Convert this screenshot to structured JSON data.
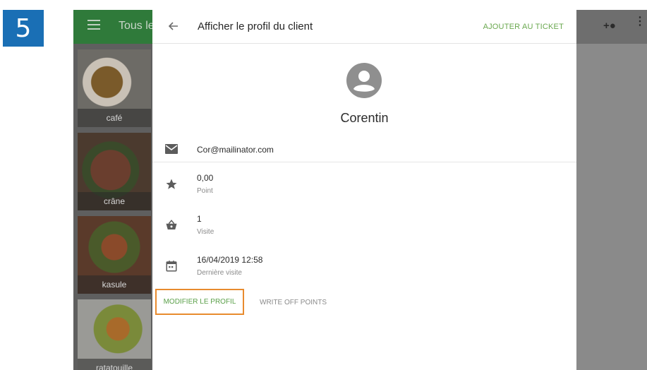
{
  "step_badge": "5",
  "background": {
    "app_title": "Tous le",
    "tiles": [
      {
        "label": "café"
      },
      {
        "label": "crâne"
      },
      {
        "label": "kasule"
      },
      {
        "label": "ratatouille"
      }
    ]
  },
  "sheet": {
    "title": "Afficher le profil du client",
    "action_add_ticket": "AJOUTER AU TICKET",
    "client_name": "Corentin",
    "email": "Cor@mailinator.com",
    "points_value": "0,00",
    "points_label": "Point",
    "visits_value": "1",
    "visits_label": "Visite",
    "last_visit_value": "16/04/2019 12:58",
    "last_visit_label": "Dernière visite",
    "edit_profile": "MODIFIER LE PROFIL",
    "write_off_points": "WRITE OFF POINTS"
  },
  "colors": {
    "accent_green": "#6aa84f",
    "highlight_orange": "#e88b2e",
    "badge_blue": "#1a6fb5"
  }
}
